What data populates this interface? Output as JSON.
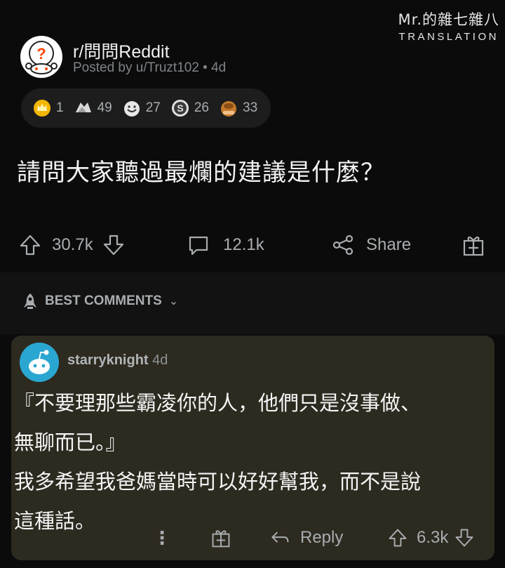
{
  "watermark": {
    "line1": "Mr.的雜七雜八",
    "line2": "TRANSLATION"
  },
  "post": {
    "subreddit": "r/問問Reddit",
    "posted_by": "Posted by u/Truzt102 • 4d",
    "awards": [
      {
        "icon": "gold-crown-award-icon",
        "count": "1"
      },
      {
        "icon": "helpful-hands-award-icon",
        "count": "49"
      },
      {
        "icon": "wholesome-face-award-icon",
        "count": "27"
      },
      {
        "icon": "silver-award-icon",
        "count": "26"
      },
      {
        "icon": "facepalm-award-icon",
        "count": "33"
      }
    ],
    "title": "請問大家聽過最爛的建議是什麼？",
    "upvotes": "30.7k",
    "comments": "12.1k",
    "share_label": "Share"
  },
  "sort": {
    "label": "BEST COMMENTS"
  },
  "comment": {
    "username": "starryknight",
    "age": "4d",
    "lines": [
      "『不要理那些霸凌你的人，他們只是沒事做、",
      "無聊而已。』",
      "我多希望我爸媽當時可以好好幫我，而不是說",
      "這種話。"
    ],
    "reply_label": "Reply",
    "score": "6.3k"
  },
  "colors": {
    "background": "#0b0b0b",
    "card": "#2d2a20",
    "avatar_blue": "#2aa7d1",
    "muted": "#a9adb0"
  }
}
